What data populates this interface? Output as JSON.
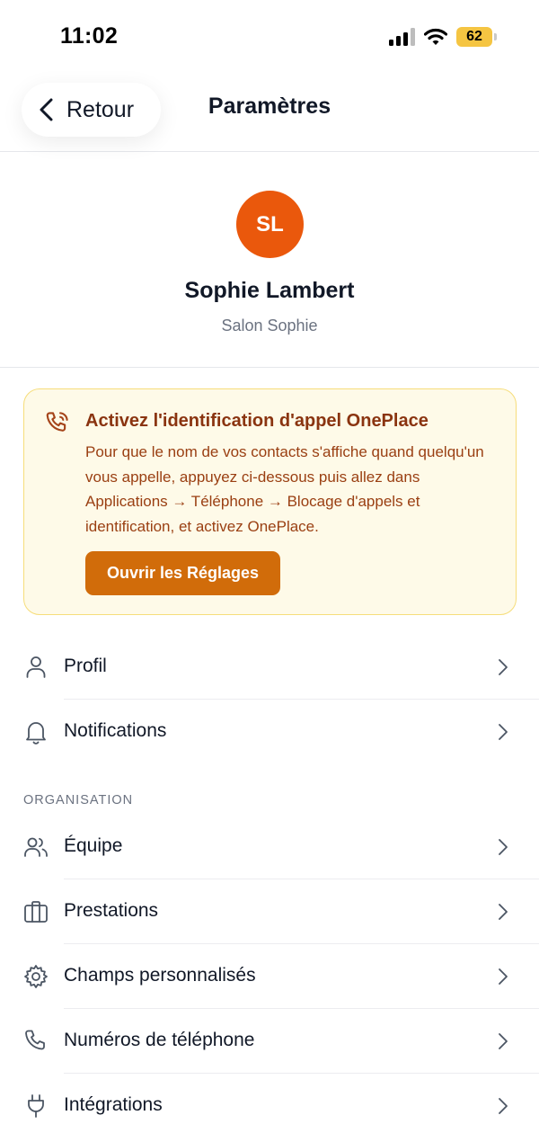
{
  "status_bar": {
    "time": "11:02",
    "battery": "62"
  },
  "nav": {
    "back_label": "Retour",
    "title": "Paramètres"
  },
  "profile": {
    "initials": "SL",
    "name": "Sophie Lambert",
    "salon": "Salon Sophie"
  },
  "banner": {
    "title": "Activez l'identification d'appel OnePlace",
    "text": "Pour que le nom de vos contacts s'affiche quand quelqu'un vous appelle, appuyez ci-dessous puis allez dans Applications → Téléphone → Blocage d'appels et identification, et activez OnePlace.",
    "button_label": "Ouvrir les Réglages",
    "icon": "phone-call-icon"
  },
  "menu": {
    "account_items": [
      {
        "label": "Profil",
        "icon": "user-icon"
      },
      {
        "label": "Notifications",
        "icon": "bell-icon"
      }
    ],
    "section_title": "ORGANISATION",
    "organisation_items": [
      {
        "label": "Équipe",
        "icon": "users-icon"
      },
      {
        "label": "Prestations",
        "icon": "briefcase-icon"
      },
      {
        "label": "Champs personnalisés",
        "icon": "gear-icon"
      },
      {
        "label": "Numéros de téléphone",
        "icon": "phone-icon"
      },
      {
        "label": "Intégrations",
        "icon": "plug-icon"
      }
    ]
  },
  "colors": {
    "avatar": "#ea580c",
    "banner_bg": "#fefae8",
    "banner_border": "#f6dd7a",
    "banner_text": "#9a3f12",
    "banner_button": "#d16c0a",
    "battery": "#f5c542"
  }
}
